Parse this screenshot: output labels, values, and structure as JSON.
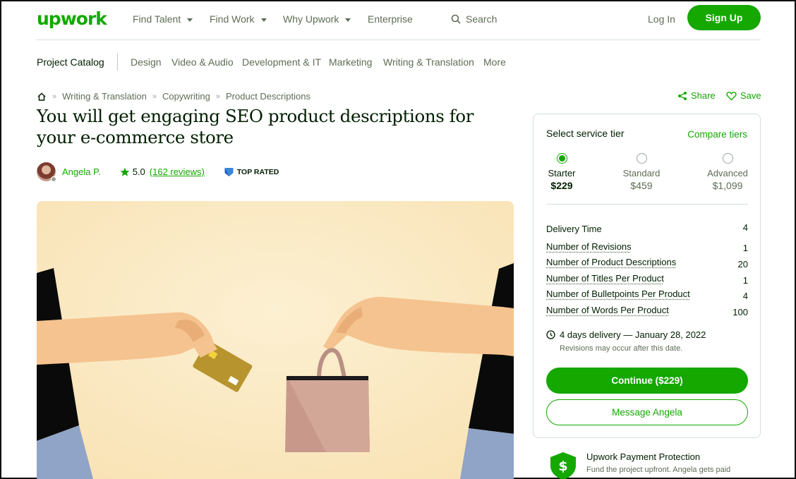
{
  "header": {
    "logo": "upwork",
    "nav": [
      {
        "label": "Find Talent",
        "dropdown": true
      },
      {
        "label": "Find Work",
        "dropdown": true
      },
      {
        "label": "Why Upwork",
        "dropdown": true
      },
      {
        "label": "Enterprise",
        "dropdown": false
      }
    ],
    "search_label": "Search",
    "login_label": "Log In",
    "signup_label": "Sign Up"
  },
  "category_bar": {
    "catalog_label": "Project Catalog",
    "items": [
      "Design",
      "Video & Audio",
      "Development & IT",
      "Marketing",
      "Writing & Translation",
      "More"
    ]
  },
  "breadcrumb": [
    "Writing & Translation",
    "Copywriting",
    "Product Descriptions"
  ],
  "actions": {
    "share_label": "Share",
    "save_label": "Save"
  },
  "title": "You will get engaging SEO product descriptions for your e-commerce store",
  "seller": {
    "name": "Angela P.",
    "rating": "5.0",
    "reviews": "(162 reviews)",
    "badge": "TOP RATED"
  },
  "service_card": {
    "heading": "Select service tier",
    "compare_label": "Compare tiers",
    "tiers": [
      {
        "name": "Starter",
        "price": "$229",
        "selected": true
      },
      {
        "name": "Standard",
        "price": "$459",
        "selected": false
      },
      {
        "name": "Advanced",
        "price": "$1,099",
        "selected": false
      }
    ],
    "specs": [
      {
        "label": "Delivery Time",
        "value": "4"
      },
      {
        "label": "Number of Revisions",
        "value": "1"
      },
      {
        "label": "Number of Product Descriptions",
        "value": "20"
      },
      {
        "label": "Number of Titles Per Product",
        "value": "1"
      },
      {
        "label": "Number of Bulletpoints Per Product",
        "value": "4"
      },
      {
        "label": "Number of Words Per Product",
        "value": "100"
      }
    ],
    "delivery_text": "4 days delivery — January 28, 2022",
    "revisions_note": "Revisions may occur after this date.",
    "continue_label": "Continue ($229)",
    "message_label": "Message Angela"
  },
  "protection": {
    "title": "Upwork Payment Protection",
    "text": "Fund the project upfront. Angela gets paid"
  },
  "colors": {
    "brand": "#14a800",
    "text": "#001e00",
    "muted": "#5e6d55"
  }
}
